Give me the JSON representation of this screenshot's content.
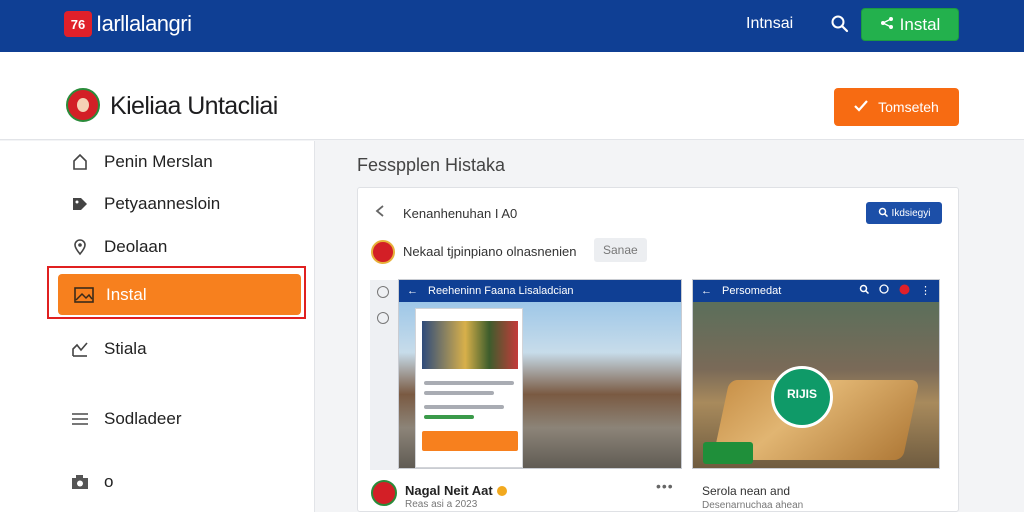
{
  "topbar": {
    "brand_logo_text": "76",
    "brand_name": "Iarllalangri",
    "link": "Intnsai",
    "install_label": "Instal",
    "brand_color": "#0f3f94",
    "install_color": "#23b14d"
  },
  "header": {
    "title": "Kieliaa Untacliai",
    "cta_label": "Tomseteh",
    "cta_color": "#f76b12"
  },
  "sidebar": {
    "items": [
      {
        "label": "Penin Merslan",
        "icon": "home-icon"
      },
      {
        "label": "Petyaannesloin",
        "icon": "tag-icon"
      },
      {
        "label": "Deolaan",
        "icon": "map-pin-icon"
      },
      {
        "label": "Instal",
        "icon": "image-icon",
        "active": true
      },
      {
        "label": "Stiala",
        "icon": "chart-icon"
      },
      {
        "label": "Sodladeer",
        "icon": "menu-icon"
      },
      {
        "label": "o",
        "icon": "camera-icon"
      }
    ],
    "active_color": "#f7801e"
  },
  "main": {
    "heading": "Fesspplen Histaka",
    "card": {
      "title": "Kenanhenuhan I A0",
      "badge": "Ikdsiegyi",
      "meta": "Nekaal tjpinpiano olnasnenien",
      "tag": "Sanae",
      "shot_a_bar": "Reeheninn Faana Lisaladcian",
      "shot_b_bar": "Persomedat",
      "watermark": "RIJIS",
      "posts": [
        {
          "name": "Nagal Neit Aat",
          "sub": "Reas asi a 2023"
        },
        {
          "name": "Serola nean and",
          "sub": "Desenarnuchaa ahean"
        }
      ]
    }
  }
}
